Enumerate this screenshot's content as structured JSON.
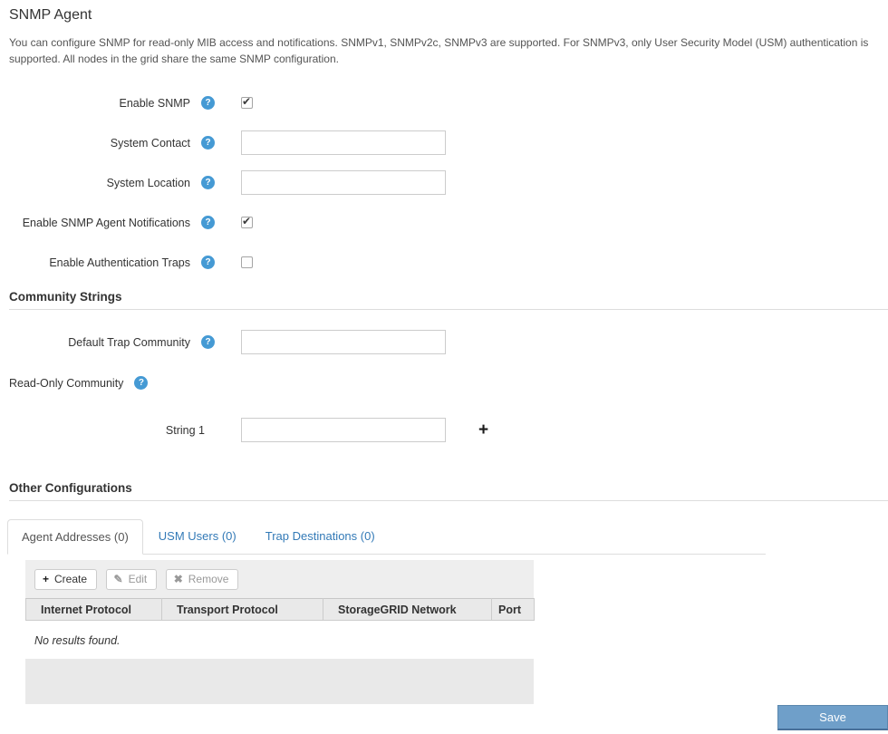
{
  "page": {
    "title": "SNMP Agent",
    "description": "You can configure SNMP for read-only MIB access and notifications. SNMPv1, SNMPv2c, SNMPv3 are supported. For SNMPv3, only User Security Model (USM) authentication is supported. All nodes in the grid share the same SNMP configuration."
  },
  "icons": {
    "help": "?",
    "plus": "+",
    "pencil": "✎",
    "cross": "✖"
  },
  "form": {
    "enable_snmp": {
      "label": "Enable SNMP",
      "checked": true
    },
    "system_contact": {
      "label": "System Contact",
      "value": ""
    },
    "system_location": {
      "label": "System Location",
      "value": ""
    },
    "agent_notifications": {
      "label": "Enable SNMP Agent Notifications",
      "checked": true
    },
    "auth_traps": {
      "label": "Enable Authentication Traps",
      "checked": false
    }
  },
  "community": {
    "heading": "Community Strings",
    "default_trap": {
      "label": "Default Trap Community",
      "value": ""
    },
    "read_only_label": "Read-Only Community",
    "string1": {
      "label": "String 1",
      "value": ""
    }
  },
  "other": {
    "heading": "Other Configurations",
    "tabs": [
      {
        "label": "Agent Addresses (0)"
      },
      {
        "label": "USM Users (0)"
      },
      {
        "label": "Trap Destinations (0)"
      }
    ],
    "toolbar": {
      "create": "Create",
      "edit": "Edit",
      "remove": "Remove"
    },
    "table": {
      "columns": [
        "Internet Protocol",
        "Transport Protocol",
        "StorageGRID Network",
        "Port"
      ],
      "empty_text": "No results found."
    }
  },
  "actions": {
    "save": "Save"
  },
  "colors": {
    "help_icon": "#459ad4",
    "link": "#337ab7",
    "save_button": "#6f9fc9"
  }
}
